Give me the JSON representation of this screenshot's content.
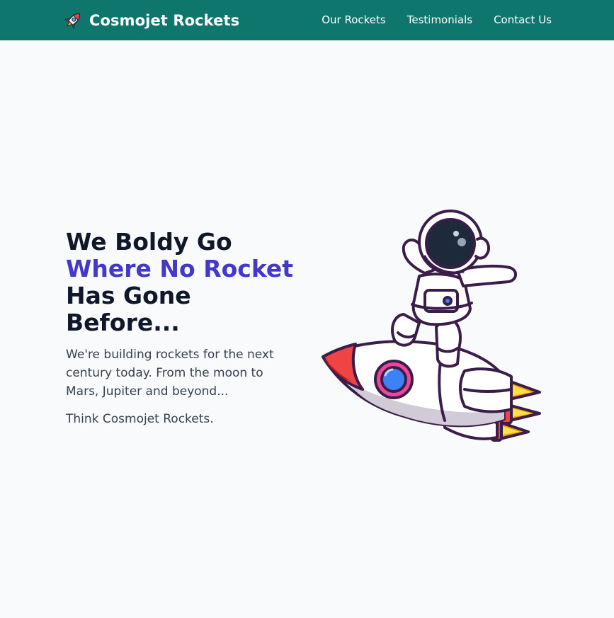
{
  "header": {
    "brand_name": "Cosmojet Rockets",
    "brand_icon": "rocket-icon",
    "nav": [
      {
        "label": "Our Rockets"
      },
      {
        "label": "Testimonials"
      },
      {
        "label": "Contact Us"
      }
    ]
  },
  "hero": {
    "title_line1": "We Boldy Go",
    "title_accent": "Where No Rocket",
    "title_line3": "Has Gone",
    "title_line4": "Before...",
    "description": "We're building rockets for the next century today. From the moon to Mars, Jupiter and beyond...",
    "tagline": "Think Cosmojet Rockets.",
    "illustration": "astronaut-on-rocket-illustration"
  },
  "colors": {
    "header_bg": "#0f766e",
    "accent": "#4338ca",
    "heading": "#0f172a",
    "page_bg": "#f8fafc"
  }
}
